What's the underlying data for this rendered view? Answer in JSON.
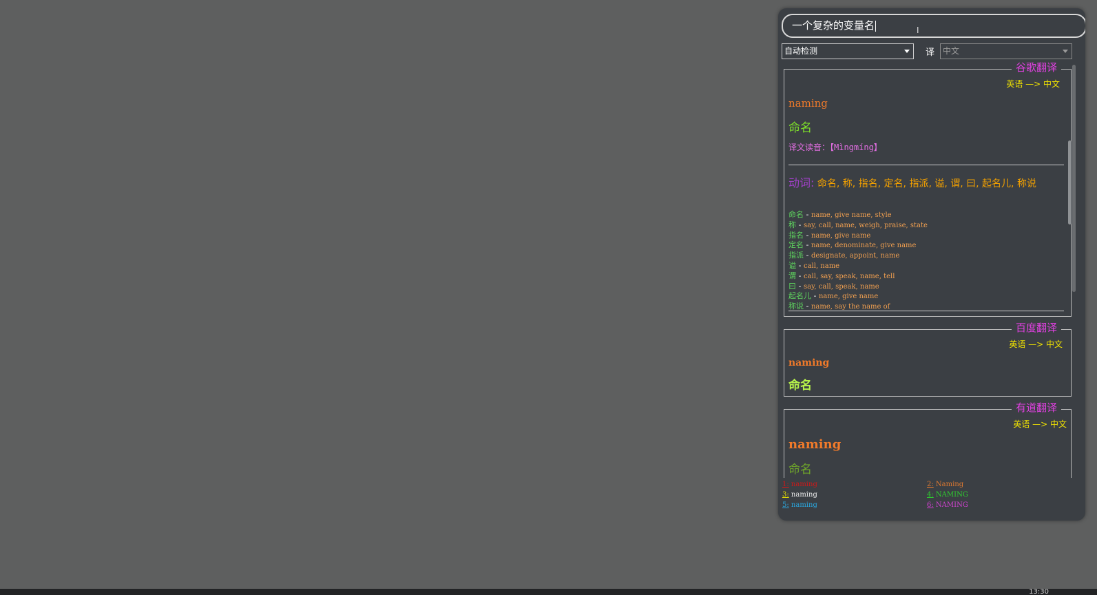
{
  "search": {
    "value": "一个复杂的变量名"
  },
  "languages": {
    "source": "自动检测",
    "translate_label": "译",
    "target": "中文"
  },
  "google": {
    "title": "谷歌翻译",
    "direction": "英语 —> 中文",
    "source_text": "naming",
    "translation": "命名",
    "pinyin": "译文读音：【Mìngmíng】",
    "pos_label": "动词:",
    "pos_words": "命名, 称, 指名, 定名, 指派, 谥, 谓, 曰, 起名儿, 称说",
    "definitions": [
      {
        "word": "命名",
        "meaning": "name, give name, style"
      },
      {
        "word": "称",
        "meaning": "say, call, name, weigh, praise, state"
      },
      {
        "word": "指名",
        "meaning": "name, give name"
      },
      {
        "word": "定名",
        "meaning": "name, denominate, give name"
      },
      {
        "word": "指派",
        "meaning": "designate, appoint, name"
      },
      {
        "word": "谥",
        "meaning": "call, name"
      },
      {
        "word": "谓",
        "meaning": "call, say, speak, name, tell"
      },
      {
        "word": "曰",
        "meaning": "say, call, speak, name"
      },
      {
        "word": "起名儿",
        "meaning": "name, give name"
      },
      {
        "word": "称说",
        "meaning": "name, say the name of"
      }
    ]
  },
  "baidu": {
    "title": "百度翻译",
    "direction": "英语 —> 中文",
    "source_text": "naming",
    "translation": "命名"
  },
  "youdao": {
    "title": "有道翻译",
    "direction": "英语 —> 中文",
    "source_text": "naming",
    "translation": "命名"
  },
  "suggestions": [
    {
      "num": "1:",
      "text": "naming",
      "color": "#d01818"
    },
    {
      "num": "2:",
      "text": "Naming",
      "color": "#e07a30"
    },
    {
      "num": "3:",
      "text": "naming",
      "color": "#e8e000"
    },
    {
      "num": "4:",
      "text": "NAMING",
      "color": "#2ed02e"
    },
    {
      "num": "5:",
      "text": "naming",
      "color": "#2aa8e0"
    },
    {
      "num": "6:",
      "text": "NAMING",
      "color": "#d040d0"
    }
  ],
  "taskbar": {
    "clock": "13:30"
  }
}
